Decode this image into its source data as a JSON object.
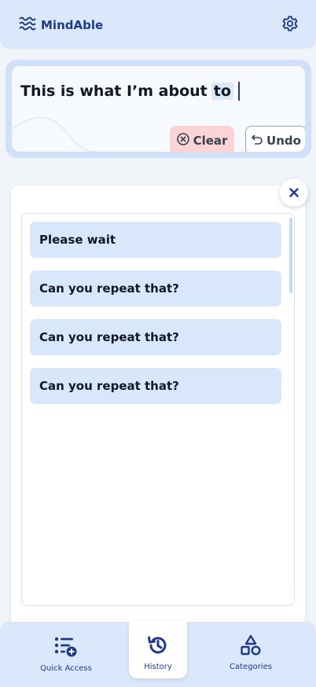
{
  "header": {
    "app_name": "MindAble"
  },
  "message": {
    "text": "This is what I’m about",
    "highlighted_word": "to",
    "clear_label": "Clear",
    "undo_label": "Undo"
  },
  "history": {
    "items": [
      {
        "label": "Please wait"
      },
      {
        "label": "Can you repeat that?"
      },
      {
        "label": "Can you repeat that?"
      },
      {
        "label": "Can you repeat that?"
      }
    ]
  },
  "nav": {
    "items": [
      {
        "label": "Quick Access",
        "icon": "quick-access-icon"
      },
      {
        "label": "History",
        "icon": "history-icon",
        "active": true
      },
      {
        "label": "Categories",
        "icon": "categories-icon"
      }
    ]
  },
  "colors": {
    "brand": "#1f3a86",
    "header_bg": "#dbe8fb",
    "clear_bg": "#fbd5d5",
    "item_bg": "#d9e7fb"
  }
}
